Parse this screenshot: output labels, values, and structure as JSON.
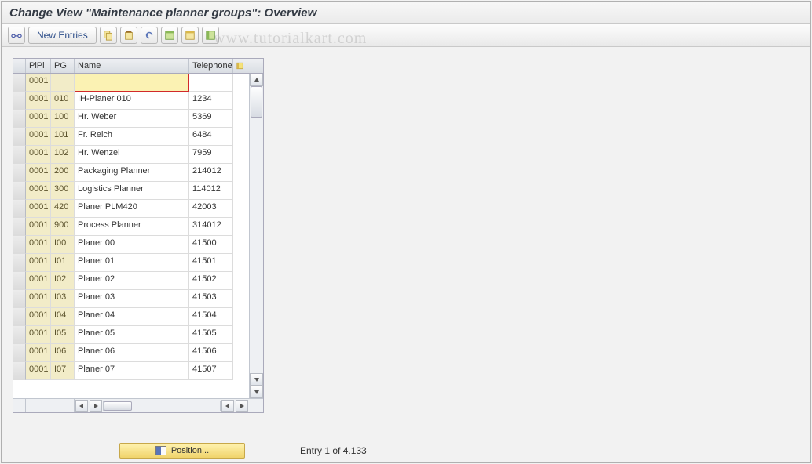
{
  "title": "Change View \"Maintenance planner groups\": Overview",
  "watermark": "www.tutorialkart.com",
  "toolbar": {
    "new_entries_label": "New Entries"
  },
  "grid": {
    "headers": {
      "plpl": "PlPl",
      "pg": "PG",
      "name": "Name",
      "telephone": "Telephone"
    },
    "active_row_index": 0,
    "rows": [
      {
        "plpl": "0001",
        "pg": "",
        "name": "",
        "tel": ""
      },
      {
        "plpl": "0001",
        "pg": "010",
        "name": "IH-Planer 010",
        "tel": "1234"
      },
      {
        "plpl": "0001",
        "pg": "100",
        "name": "Hr. Weber",
        "tel": "5369"
      },
      {
        "plpl": "0001",
        "pg": "101",
        "name": "Fr. Reich",
        "tel": "6484"
      },
      {
        "plpl": "0001",
        "pg": "102",
        "name": "Hr. Wenzel",
        "tel": "7959"
      },
      {
        "plpl": "0001",
        "pg": "200",
        "name": "Packaging Planner",
        "tel": "214012"
      },
      {
        "plpl": "0001",
        "pg": "300",
        "name": "Logistics Planner",
        "tel": "114012"
      },
      {
        "plpl": "0001",
        "pg": "420",
        "name": "Planer PLM420",
        "tel": "42003"
      },
      {
        "plpl": "0001",
        "pg": "900",
        "name": "Process Planner",
        "tel": "314012"
      },
      {
        "plpl": "0001",
        "pg": "I00",
        "name": "Planer 00",
        "tel": "41500"
      },
      {
        "plpl": "0001",
        "pg": "I01",
        "name": "Planer 01",
        "tel": "41501"
      },
      {
        "plpl": "0001",
        "pg": "I02",
        "name": "Planer 02",
        "tel": "41502"
      },
      {
        "plpl": "0001",
        "pg": "I03",
        "name": "Planer 03",
        "tel": "41503"
      },
      {
        "plpl": "0001",
        "pg": "I04",
        "name": "Planer 04",
        "tel": "41504"
      },
      {
        "plpl": "0001",
        "pg": "I05",
        "name": "Planer 05",
        "tel": "41505"
      },
      {
        "plpl": "0001",
        "pg": "I06",
        "name": "Planer 06",
        "tel": "41506"
      },
      {
        "plpl": "0001",
        "pg": "I07",
        "name": "Planer 07",
        "tel": "41507"
      }
    ]
  },
  "footer": {
    "position_label": "Position...",
    "entry_text": "Entry 1 of 4.133"
  }
}
